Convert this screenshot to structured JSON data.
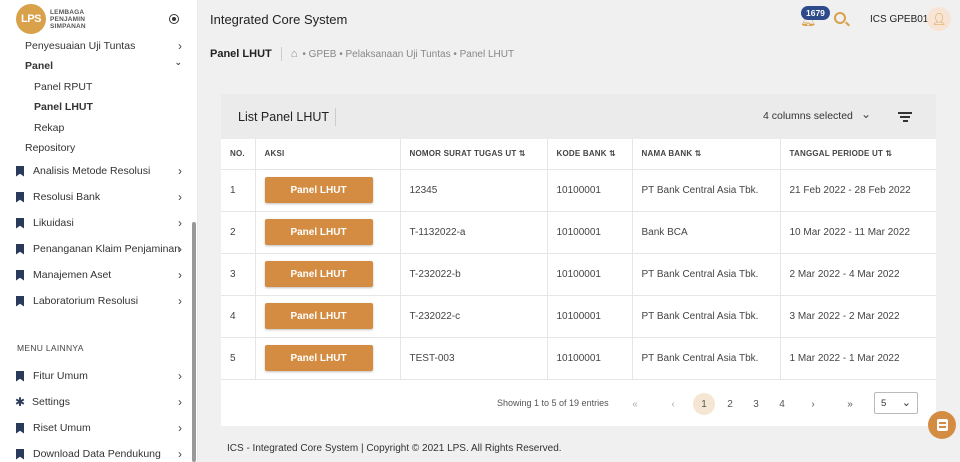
{
  "app": {
    "title": "Integrated Core System",
    "logo_mark": "LPS",
    "logo_text": [
      "LEMBAGA",
      "PENJAMIN",
      "SIMPANAN"
    ]
  },
  "header": {
    "notification_count": "1679",
    "user_name": "ICS GPEB01"
  },
  "sidebar": {
    "items": [
      {
        "label": "Penyesuaian Uji Tuntas",
        "chevron": "›"
      },
      {
        "label": "Panel",
        "chevron": "⌄"
      },
      {
        "label": "Panel RPUT"
      },
      {
        "label": "Panel LHUT"
      },
      {
        "label": "Rekap"
      },
      {
        "label": "Repository"
      },
      {
        "label": "Analisis Metode Resolusi",
        "chevron": "›"
      },
      {
        "label": "Resolusi Bank",
        "chevron": "›"
      },
      {
        "label": "Likuidasi",
        "chevron": "›"
      },
      {
        "label": "Penanganan Klaim Penjaminan",
        "chevron": "›"
      },
      {
        "label": "Manajemen Aset",
        "chevron": "›"
      },
      {
        "label": "Laboratorium Resolusi",
        "chevron": "›"
      }
    ],
    "section_label": "MENU LAINNYA",
    "other_items": [
      {
        "label": "Fitur Umum",
        "chevron": "›"
      },
      {
        "label": "Settings",
        "chevron": "›"
      },
      {
        "label": "Riset Umum",
        "chevron": "›"
      },
      {
        "label": "Download Data Pendukung",
        "chevron": "›"
      }
    ]
  },
  "breadcrumb": {
    "title": "Panel LHUT",
    "path": "• GPEB • Pelaksanaan Uji Tuntas • Panel LHUT"
  },
  "card": {
    "title": "List Panel LHUT",
    "columns_selected": "4 columns selected",
    "columns": [
      "NO.",
      "AKSI",
      "NOMOR SURAT TUGAS UT ⇅",
      "KODE BANK ⇅",
      "NAMA BANK ⇅",
      "TANGGAL PERIODE UT ⇅"
    ],
    "rows": [
      {
        "no": "1",
        "action": "Panel LHUT",
        "nomor": "12345",
        "kode": "10100001",
        "nama": "PT Bank Central Asia Tbk.",
        "tanggal": "21 Feb 2022 - 28 Feb 2022"
      },
      {
        "no": "2",
        "action": "Panel LHUT",
        "nomor": "T-1132022-a",
        "kode": "10100001",
        "nama": "Bank BCA",
        "tanggal": "10 Mar 2022 - 11 Mar 2022"
      },
      {
        "no": "3",
        "action": "Panel LHUT",
        "nomor": "T-232022-b",
        "kode": "10100001",
        "nama": "PT Bank Central Asia Tbk.",
        "tanggal": "2 Mar 2022 - 4 Mar 2022"
      },
      {
        "no": "4",
        "action": "Panel LHUT",
        "nomor": "T-232022-c",
        "kode": "10100001",
        "nama": "PT Bank Central Asia Tbk.",
        "tanggal": "3 Mar 2022 - 2 Mar 2022"
      },
      {
        "no": "5",
        "action": "Panel LHUT",
        "nomor": "TEST-003",
        "kode": "10100001",
        "nama": "PT Bank Central Asia Tbk.",
        "tanggal": "1 Mar 2022 - 1 Mar 2022"
      }
    ]
  },
  "pagination": {
    "showing": "Showing 1 to 5 of 19 entries",
    "first": "«",
    "prev": "‹",
    "next": "›",
    "last": "»",
    "pages": [
      "1",
      "2",
      "3",
      "4"
    ],
    "active_page": "1",
    "per_page": "5"
  },
  "footer": {
    "text": "ICS - Integrated Core System | Copyright © 2021 LPS. All Rights Reserved."
  },
  "colors": {
    "accent": "#d48c42",
    "badge": "#2d4a8a",
    "nav_icon": "#2a3a5a"
  }
}
